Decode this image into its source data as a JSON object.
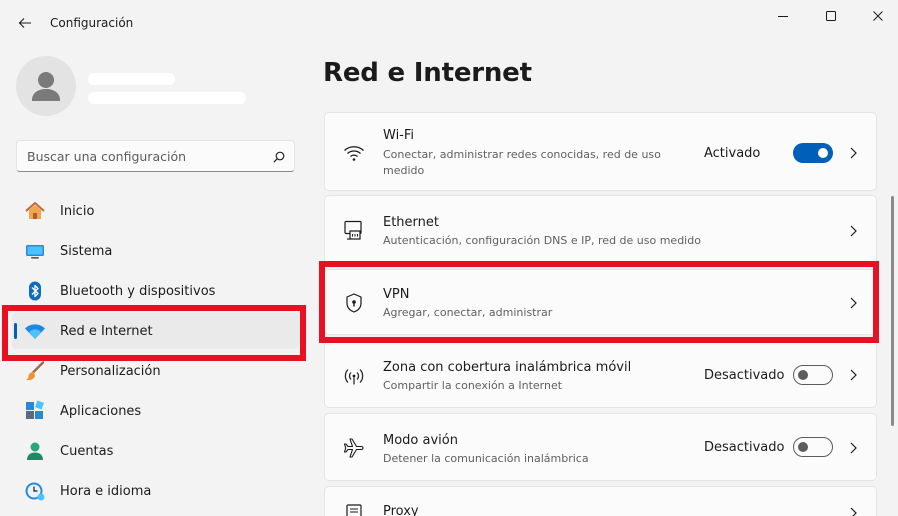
{
  "window": {
    "app_title": "Configuración",
    "back_icon": "back-arrow-icon",
    "minimize_icon": "minimize-icon",
    "maximize_icon": "maximize-icon",
    "close_icon": "close-icon"
  },
  "search": {
    "placeholder": "Buscar una configuración",
    "icon": "search-icon"
  },
  "sidebar": {
    "items": [
      {
        "label": "Inicio",
        "icon": "home-icon"
      },
      {
        "label": "Sistema",
        "icon": "system-display-icon"
      },
      {
        "label": "Bluetooth y dispositivos",
        "icon": "bluetooth-icon"
      },
      {
        "label": "Red e Internet",
        "icon": "wifi-network-icon",
        "active": true
      },
      {
        "label": "Personalización",
        "icon": "paintbrush-icon"
      },
      {
        "label": "Aplicaciones",
        "icon": "apps-icon"
      },
      {
        "label": "Cuentas",
        "icon": "accounts-person-icon"
      },
      {
        "label": "Hora e idioma",
        "icon": "clock-globe-icon"
      }
    ]
  },
  "main": {
    "title": "Red e Internet",
    "cards": [
      {
        "title": "Wi-Fi",
        "subtitle": "Conectar, administrar redes conocidas, red de uso medido",
        "status": "Activado",
        "toggle": true,
        "icon": "wifi-icon"
      },
      {
        "title": "Ethernet",
        "subtitle": "Autenticación, configuración DNS e IP, red de uso medido",
        "icon": "ethernet-icon"
      },
      {
        "title": "VPN",
        "subtitle": "Agregar, conectar, administrar",
        "icon": "vpn-shield-icon"
      },
      {
        "title": "Zona con cobertura inalámbrica móvil",
        "subtitle": "Compartir la conexión a Internet",
        "status": "Desactivado",
        "toggle": false,
        "icon": "mobile-hotspot-icon"
      },
      {
        "title": "Modo avión",
        "subtitle": "Detener la comunicación inalámbrica",
        "status": "Desactivado",
        "toggle": false,
        "icon": "airplane-icon"
      },
      {
        "title": "Proxy",
        "icon": "proxy-icon"
      }
    ]
  },
  "colors": {
    "accent": "#005fb8",
    "highlight": "#e81123",
    "background": "#f3f3f3",
    "card": "#fbfbfb"
  }
}
